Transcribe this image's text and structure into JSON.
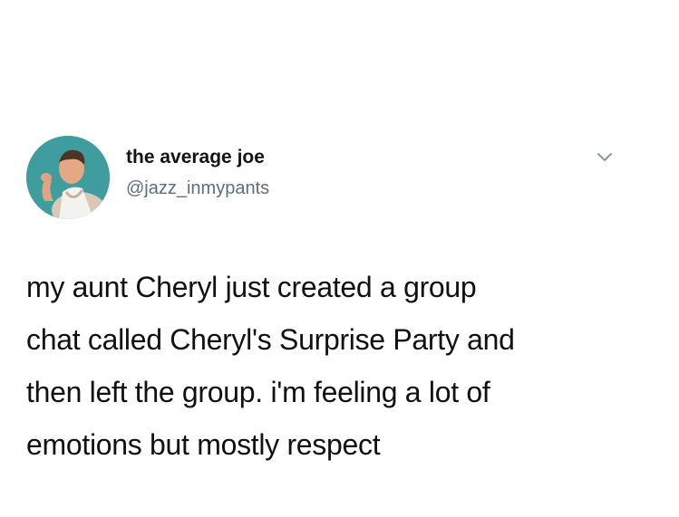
{
  "tweet": {
    "author": {
      "display_name": "the average joe",
      "handle": "@jazz_inmypants",
      "avatar_icon": "user-avatar-photo"
    },
    "more_icon": "chevron-down-icon",
    "text_lines": [
      "my aunt Cheryl just created a group",
      "chat called Cheryl's Surprise Party and",
      "then left the group. i'm feeling a lot of",
      "emotions but mostly respect"
    ]
  },
  "colors": {
    "background": "#ffffff",
    "text": "#111111",
    "handle": "#5f6e7a",
    "avatar_bg": "#3f9c9f"
  }
}
